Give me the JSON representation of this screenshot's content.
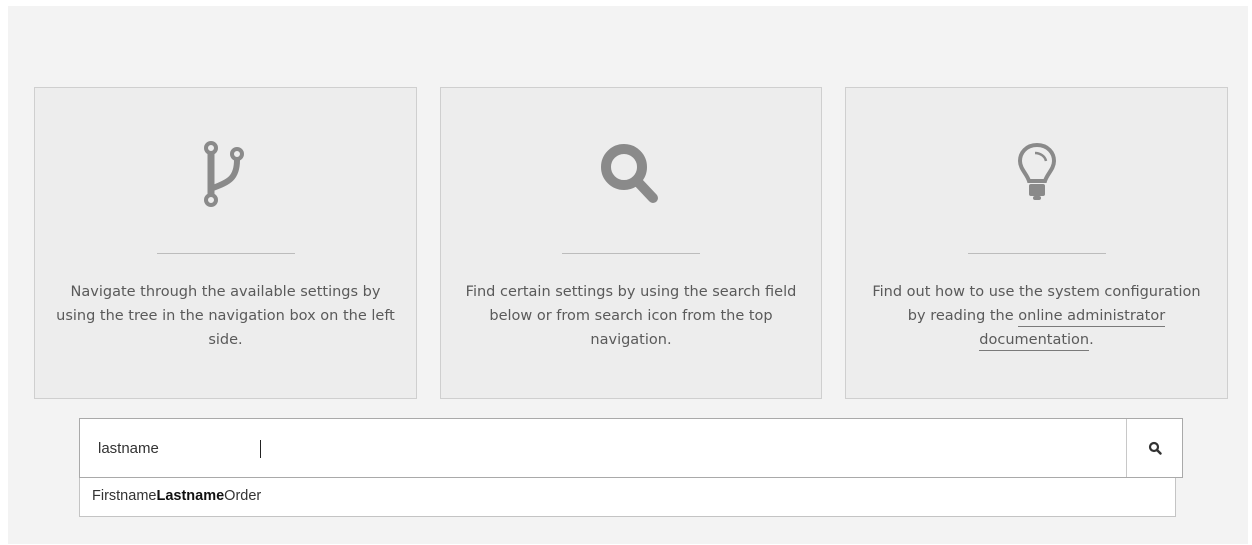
{
  "cards": [
    {
      "icon": "branch-icon",
      "text": "Navigate through the available settings by using the tree in the navigation box on the left side."
    },
    {
      "icon": "search-icon",
      "text": "Find certain settings by using the search field below or from search icon from the top navigation."
    },
    {
      "icon": "lightbulb-icon",
      "text_before": "Find out how to use the system configuration by reading the ",
      "link_text": "online administrator documentation",
      "text_after": "."
    }
  ],
  "search": {
    "value": "lastname",
    "button_icon": "search-icon"
  },
  "suggestions": [
    {
      "prefix": "Firstname",
      "match": "Lastname",
      "suffix": "Order"
    }
  ],
  "colors": {
    "panel_bg": "#f3f3f3",
    "card_bg": "#ededed",
    "icon_color": "#8a8a8a",
    "text_color": "#5a5a5a"
  }
}
